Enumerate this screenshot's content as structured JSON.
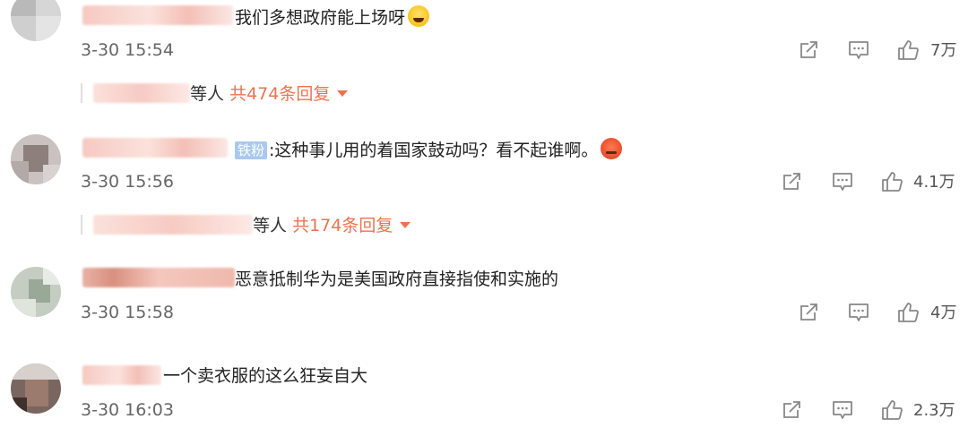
{
  "comments": [
    {
      "text": "我们多想政府能上场呀",
      "emoji": "laugh-cry-emoji",
      "time": "3-30 15:54",
      "likes": "7万",
      "replies": {
        "etc": "等人",
        "total": "共474条回复"
      }
    },
    {
      "badge": "铁粉",
      "text": ":这种事儿用的着国家鼓动吗？看不起谁啊。",
      "emoji": "angry-emoji",
      "time": "3-30 15:56",
      "likes": "4.1万",
      "replies": {
        "etc": "等人",
        "total": "共174条回复"
      }
    },
    {
      "text": "恶意抵制华为是美国政府直接指使和实施的",
      "time": "3-30 15:58",
      "likes": "4万"
    },
    {
      "text": "一个卖衣服的这么狂妄自大",
      "time": "3-30 16:03",
      "likes": "2.3万"
    }
  ],
  "colors": {
    "accent": "#eb7350",
    "text": "#222222",
    "meta": "#666666",
    "icon": "#888888"
  },
  "icons": [
    "share-icon",
    "comment-icon",
    "like-icon",
    "expand-caret-icon"
  ]
}
